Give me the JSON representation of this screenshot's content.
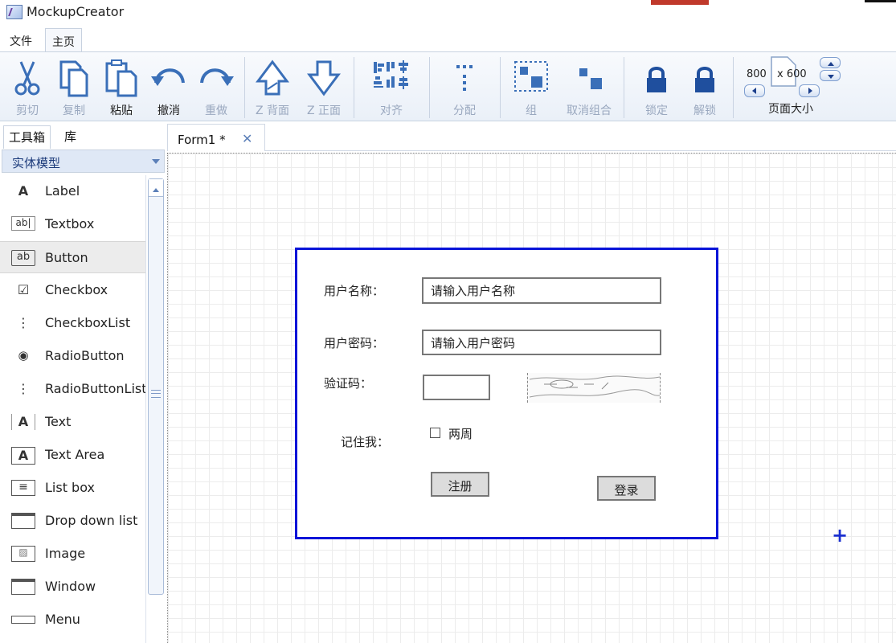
{
  "app": {
    "title": "MockupCreator"
  },
  "menu": {
    "tabs": [
      "文件",
      "主页"
    ]
  },
  "ribbon": {
    "buttons": [
      {
        "label": "剪切",
        "icon": "scissors-icon",
        "enabled": false
      },
      {
        "label": "复制",
        "icon": "copy-icon",
        "enabled": false
      },
      {
        "label": "粘贴",
        "icon": "paste-icon",
        "enabled": true
      },
      {
        "label": "撤消",
        "icon": "undo-icon",
        "enabled": true
      },
      {
        "label": "重做",
        "icon": "redo-icon",
        "enabled": false
      },
      {
        "label": "Z 背面",
        "icon": "send-back-icon",
        "enabled": false
      },
      {
        "label": "Z 正面",
        "icon": "bring-front-icon",
        "enabled": false
      },
      {
        "label": "对齐",
        "icon": "align-icon",
        "enabled": false
      },
      {
        "label": "分配",
        "icon": "distribute-icon",
        "enabled": false
      },
      {
        "label": "组",
        "icon": "group-icon",
        "enabled": false
      },
      {
        "label": "取消组合",
        "icon": "ungroup-icon",
        "enabled": false
      },
      {
        "label": "锁定",
        "icon": "lock-icon",
        "enabled": false
      },
      {
        "label": "解锁",
        "icon": "unlock-icon",
        "enabled": false
      }
    ],
    "page_size": {
      "width": "800",
      "height": "x 600",
      "label": "页面大小"
    }
  },
  "panel": {
    "tabs": [
      "工具箱",
      "库"
    ],
    "category": "实体模型",
    "tools": [
      {
        "label": "Label",
        "icon": "A"
      },
      {
        "label": "Textbox",
        "icon": "ab|"
      },
      {
        "label": "Button",
        "icon": "ab"
      },
      {
        "label": "Checkbox",
        "icon": "☑"
      },
      {
        "label": "CheckboxList",
        "icon": "⋮"
      },
      {
        "label": "RadioButton",
        "icon": "◉"
      },
      {
        "label": "RadioButtonList",
        "icon": "⋮"
      },
      {
        "label": "Text",
        "icon": "A"
      },
      {
        "label": "Text Area",
        "icon": "A"
      },
      {
        "label": "List box",
        "icon": "≡"
      },
      {
        "label": "Drop down list",
        "icon": "▭"
      },
      {
        "label": "Image",
        "icon": "▨"
      },
      {
        "label": "Window",
        "icon": "▭"
      },
      {
        "label": "Menu",
        "icon": "▭"
      }
    ]
  },
  "document": {
    "tab_name": "Form1 *",
    "close": "✕"
  },
  "form": {
    "username_label": "用户名称：",
    "username_placeholder": "请输入用户名称",
    "password_label": "用户密码：",
    "password_placeholder": "请输入用户密码",
    "captcha_label": "验证码：",
    "remember_label": "记住我：",
    "remember_option": "两周",
    "register_button": "注册",
    "login_button": "登录"
  },
  "colors": {
    "frame": "#0a14d8",
    "accent": "#1b3a7a",
    "disabled": "#9aa8bf"
  }
}
